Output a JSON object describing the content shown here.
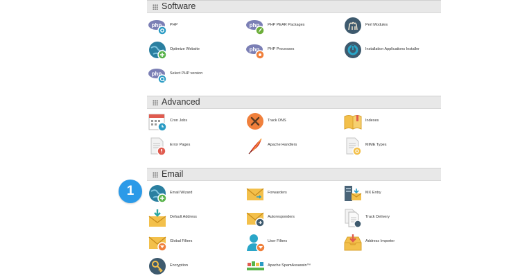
{
  "sections": {
    "software": "Software",
    "advanced": "Advanced",
    "email": "Email"
  },
  "software_items": [
    {
      "label": "PHP",
      "icon": "php-icon"
    },
    {
      "label": "PHP PEAR Packages",
      "icon": "php-pear-icon"
    },
    {
      "label": "Perl Modules",
      "icon": "perl-camel-icon"
    },
    {
      "label": "Optimize Website",
      "icon": "globe-optimize-icon"
    },
    {
      "label": "PHP Processes",
      "icon": "php-processes-icon"
    },
    {
      "label": "Installation Applications Installer",
      "icon": "installer-icon"
    },
    {
      "label": "Select PHP version",
      "icon": "php-version-icon"
    }
  ],
  "advanced_items": [
    {
      "label": "Cron Jobs",
      "icon": "calendar-clock-icon"
    },
    {
      "label": "Track DNS",
      "icon": "tools-icon"
    },
    {
      "label": "Indexes",
      "icon": "book-icon"
    },
    {
      "label": "Error Pages",
      "icon": "error-page-icon"
    },
    {
      "label": "Apache Handlers",
      "icon": "feather-icon"
    },
    {
      "label": "MIME Types",
      "icon": "mime-icon"
    }
  ],
  "email_items": [
    {
      "label": "Email Wizard",
      "icon": "globe-email-icon"
    },
    {
      "label": "Forwarders",
      "icon": "envelope-forward-icon"
    },
    {
      "label": "MX Entry",
      "icon": "mx-entry-icon"
    },
    {
      "label": "Default Address",
      "icon": "envelope-download-icon"
    },
    {
      "label": "Autoresponders",
      "icon": "envelope-auto-icon"
    },
    {
      "label": "Track Delivery",
      "icon": "track-delivery-icon"
    },
    {
      "label": "Global Filters",
      "icon": "envelope-filter-icon"
    },
    {
      "label": "User Filters",
      "icon": "user-filter-icon"
    },
    {
      "label": "Address Importer",
      "icon": "inbox-import-icon"
    },
    {
      "label": "Encryption",
      "icon": "key-icon"
    },
    {
      "label": "Apache SpamAssassin™",
      "icon": "spamassassin-icon"
    }
  ],
  "step_badge": "1",
  "colors": {
    "header_bg": "#e8e8e8",
    "badge": "#2b9ae8",
    "php_purple": "#7b7fb5",
    "envelope_yellow": "#f3c04b",
    "orange": "#f0803c",
    "teal": "#2a8fa8"
  }
}
